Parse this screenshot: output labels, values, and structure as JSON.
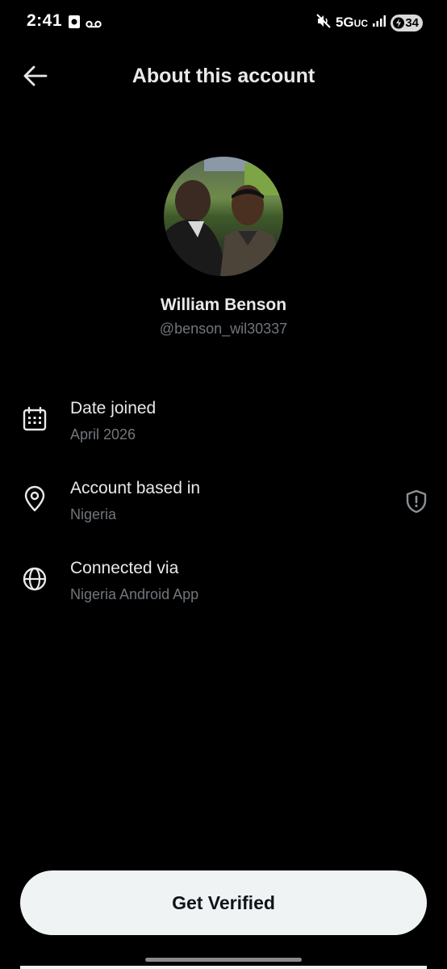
{
  "status_bar": {
    "time": "2:41",
    "network": "5G",
    "network_suffix": "UC",
    "battery": "34",
    "icons": [
      "app-notification-icon",
      "voicemail-icon",
      "mute-icon",
      "signal-icon",
      "battery-charging-icon"
    ]
  },
  "header": {
    "title": "About this account",
    "back_icon": "arrow-left-icon"
  },
  "profile": {
    "name": "William Benson",
    "handle": "@benson_wil30337"
  },
  "info": {
    "date_joined": {
      "title": "Date joined",
      "value": "April 2026",
      "icon": "calendar-icon"
    },
    "based_in": {
      "title": "Account based in",
      "value": "Nigeria",
      "icon": "location-pin-icon",
      "trailing_icon": "shield-alert-icon"
    },
    "connected_via": {
      "title": "Connected via",
      "value": "Nigeria Android App",
      "icon": "globe-icon"
    }
  },
  "cta": {
    "label": "Get Verified"
  },
  "colors": {
    "background": "#000000",
    "primary_text": "#e7e9ea",
    "secondary_text": "#71767b",
    "button_bg": "#eff3f4",
    "button_text": "#0f1419"
  }
}
